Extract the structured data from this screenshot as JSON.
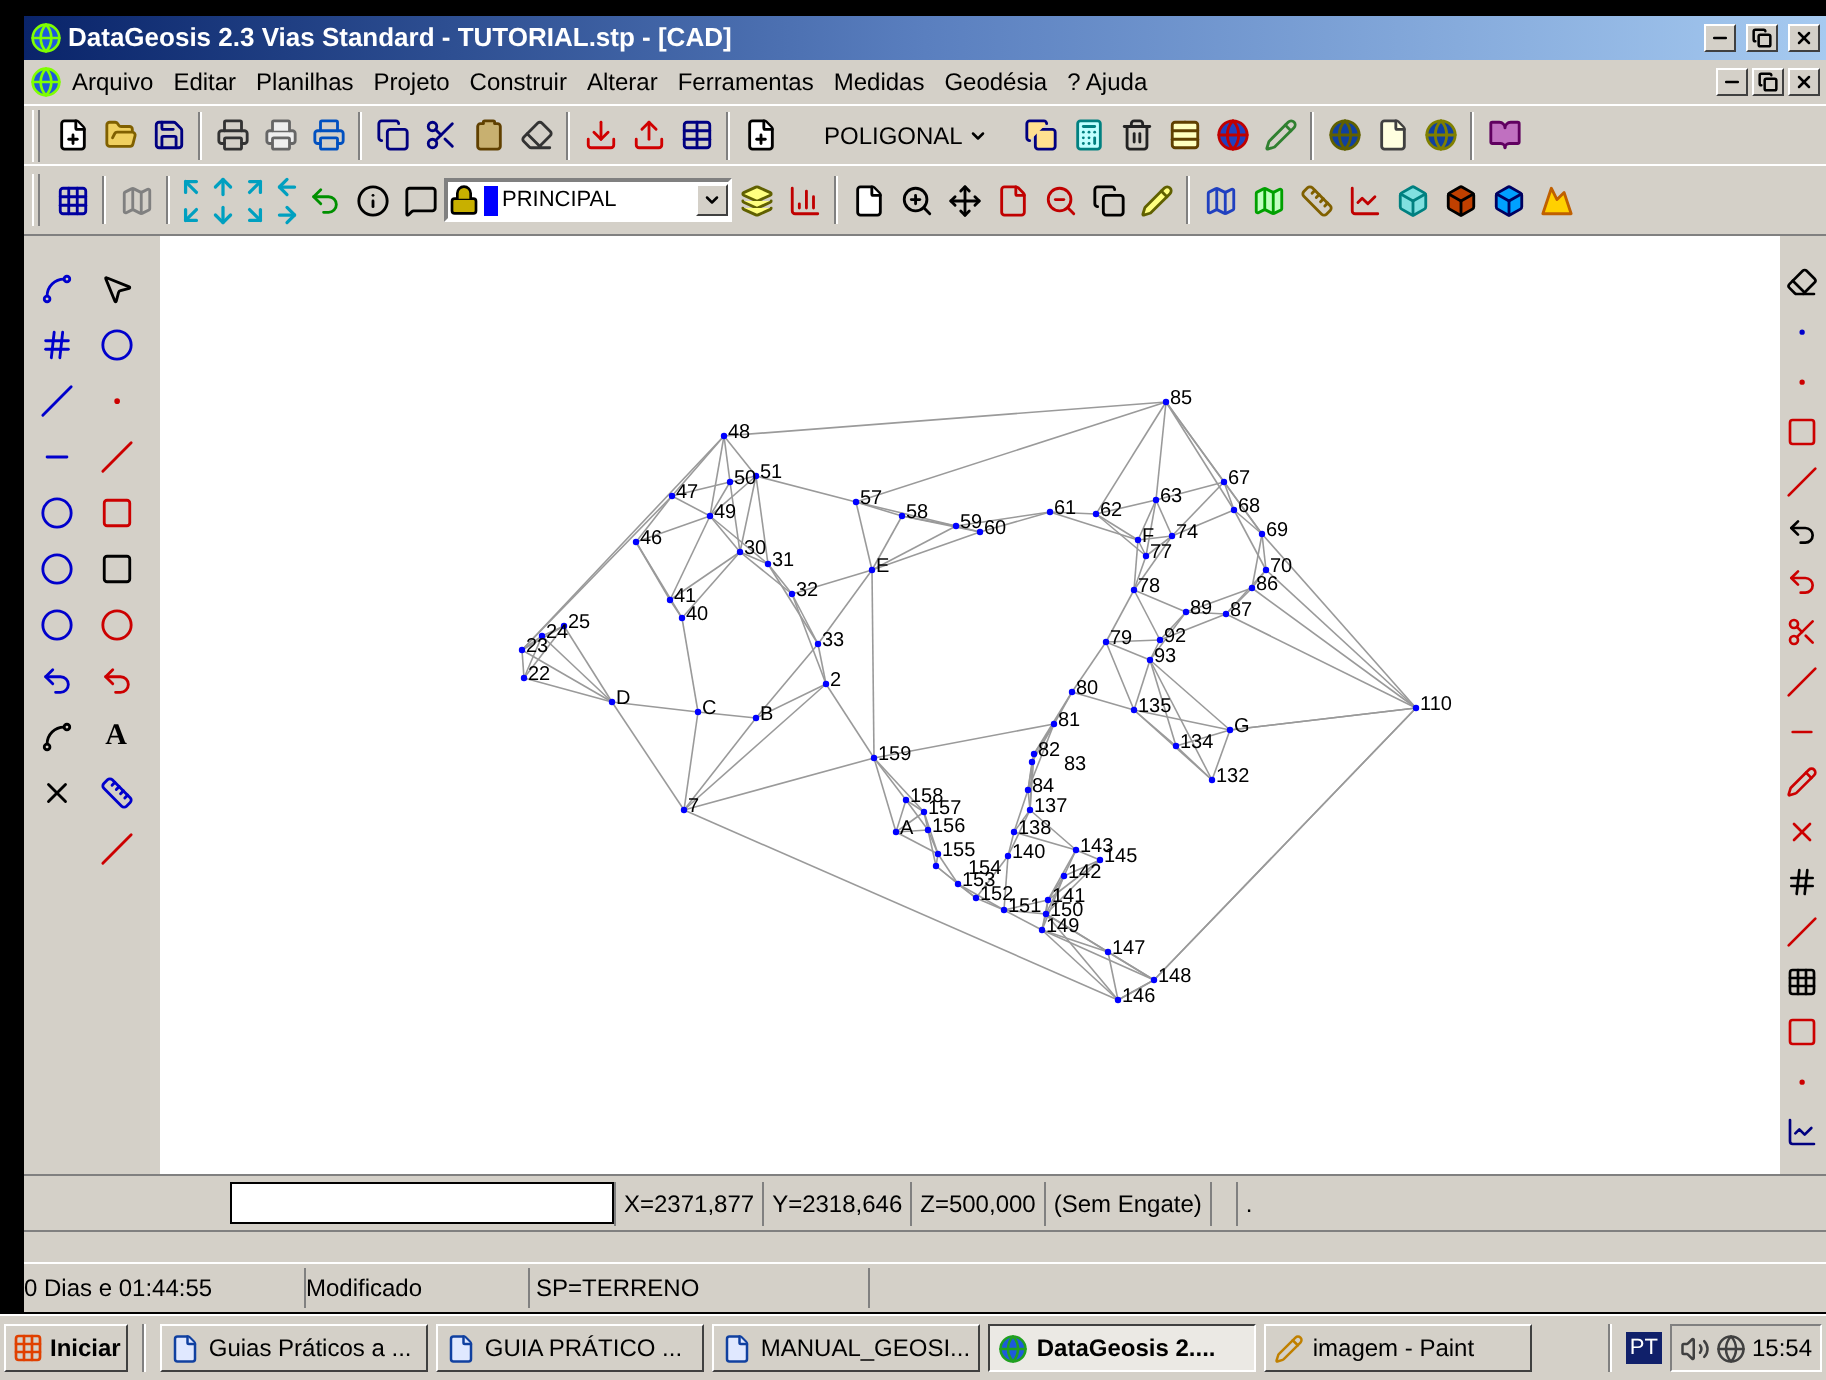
{
  "window": {
    "title": "DataGeosis 2.3 Vias Standard - TUTORIAL.stp - [CAD]"
  },
  "menu": [
    "Arquivo",
    "Editar",
    "Planilhas",
    "Projeto",
    "Construir",
    "Alterar",
    "Ferramentas",
    "Medidas",
    "Geodésia",
    "? Ajuda"
  ],
  "toolbar": {
    "mode_dropdown": "POLIGONAL",
    "layer_select": "PRINCIPAL"
  },
  "left_toolbar": {
    "text_tool": "A"
  },
  "canvas": {
    "points": [
      "85",
      "48",
      "50",
      "51",
      "67",
      "46",
      "47",
      "49",
      "30",
      "31",
      "57",
      "E",
      "58",
      "59",
      "60",
      "61",
      "62",
      "F",
      "77",
      "63",
      "74",
      "68",
      "69",
      "70",
      "23",
      "24",
      "25",
      "41",
      "40",
      "32",
      "33",
      "79",
      "78",
      "92",
      "93",
      "89",
      "87",
      "86",
      "22",
      "D",
      "C",
      "B",
      "2",
      "81",
      "80",
      "135",
      "G",
      "110",
      "159",
      "83",
      "82",
      "134",
      "7",
      "158",
      "157",
      "84",
      "137",
      "132",
      "A",
      "156",
      "138",
      "154",
      "155",
      "153",
      "140",
      "142",
      "143",
      "145",
      "152",
      "151",
      "141",
      "150",
      "149",
      "147",
      "148",
      "146"
    ]
  },
  "command_bar": {
    "x": "X=2371,877",
    "y": "Y=2318,646",
    "z": "Z=500,000",
    "snap": "(Sem Engate)",
    "extra": "."
  },
  "status_bar": [
    "0 Dias e 01:44:55",
    "Modificado",
    "SP=TERRENO"
  ],
  "taskbar": {
    "start": "Iniciar",
    "tasks": [
      {
        "label": "Guias Práticos a ...",
        "selected": false,
        "kind": "doc"
      },
      {
        "label": "GUIA PRÁTICO ...",
        "selected": false,
        "kind": "doc"
      },
      {
        "label": "MANUAL_GEOSI...",
        "selected": false,
        "kind": "doc"
      },
      {
        "label": "DataGeosis 2....",
        "selected": true,
        "kind": "globe"
      },
      {
        "label": "imagem - Paint",
        "selected": false,
        "kind": "paint"
      }
    ],
    "language": "PT",
    "clock": "15:54"
  }
}
